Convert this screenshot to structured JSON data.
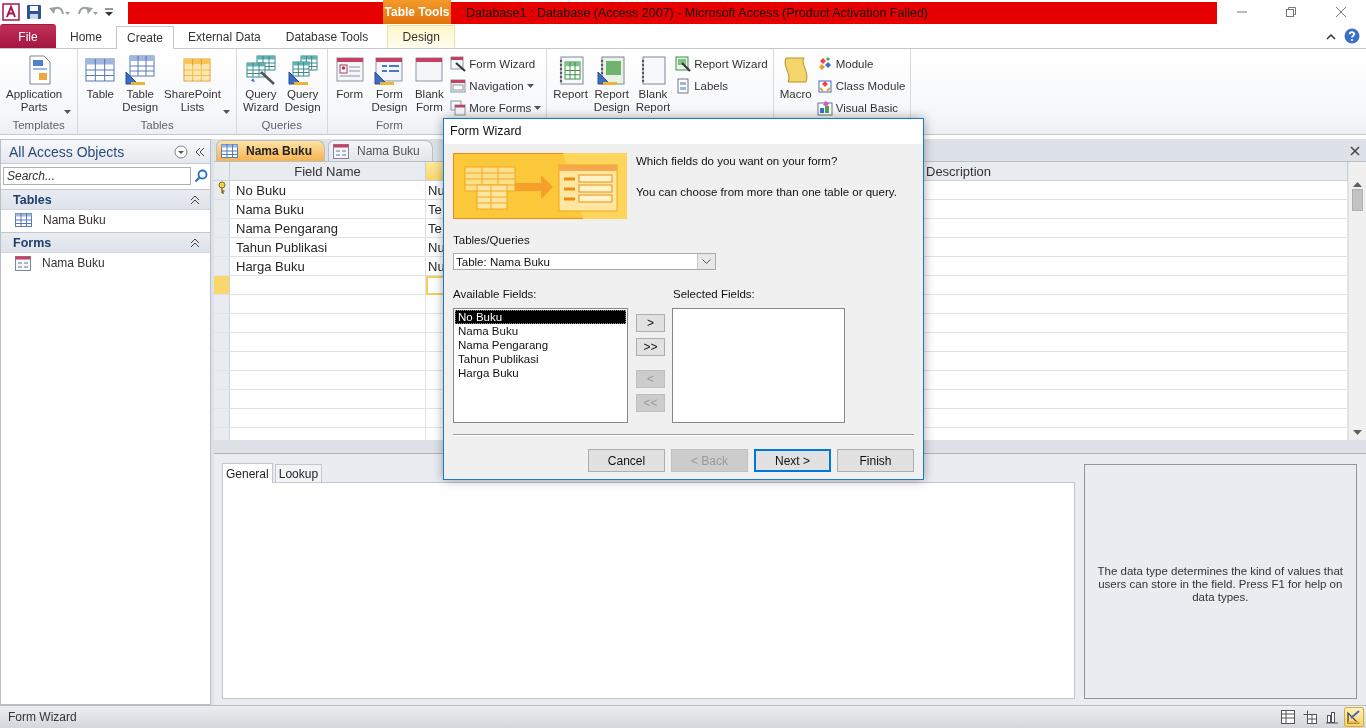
{
  "title_bar": {
    "contextual_group": "Table Tools",
    "title": "Database1 : Database (Access 2007)  -  Microsoft Access (Product Activation Failed)"
  },
  "ribbon_tabs": [
    {
      "label": "File",
      "kind": "file",
      "selected": false
    },
    {
      "label": "Home",
      "kind": "normal",
      "selected": false
    },
    {
      "label": "Create",
      "kind": "normal",
      "selected": true
    },
    {
      "label": "External Data",
      "kind": "normal",
      "selected": false
    },
    {
      "label": "Database Tools",
      "kind": "normal",
      "selected": false
    },
    {
      "label": "Design",
      "kind": "contextual",
      "selected": false
    }
  ],
  "ribbon_groups": [
    {
      "label": "Templates",
      "items": [
        {
          "kind": "large",
          "label": "Application Parts",
          "dropdown": true
        }
      ]
    },
    {
      "label": "Tables",
      "items": [
        {
          "kind": "large",
          "label": "Table",
          "dropdown": false
        },
        {
          "kind": "large",
          "label": "Table Design",
          "dropdown": false
        },
        {
          "kind": "large",
          "label": "SharePoint Lists",
          "dropdown": true
        }
      ]
    },
    {
      "label": "Queries",
      "items": [
        {
          "kind": "large",
          "label": "Query Wizard",
          "dropdown": false
        },
        {
          "kind": "large",
          "label": "Query Design",
          "dropdown": false
        }
      ]
    },
    {
      "label": "Form",
      "items": [
        {
          "kind": "large",
          "label": "Form",
          "dropdown": false
        },
        {
          "kind": "large",
          "label": "Form Design",
          "dropdown": false
        },
        {
          "kind": "large",
          "label": "Blank Form",
          "dropdown": false
        },
        {
          "kind": "small",
          "label": "Form Wizard",
          "dropdown": false
        },
        {
          "kind": "small",
          "label": "Navigation",
          "dropdown": true
        },
        {
          "kind": "small",
          "label": "More Forms",
          "dropdown": true
        }
      ]
    },
    {
      "items": [
        {
          "kind": "large",
          "label": "Report",
          "dropdown": false
        },
        {
          "kind": "large",
          "label": "Report Design",
          "dropdown": false
        },
        {
          "kind": "large",
          "label": "Blank Report",
          "dropdown": false
        },
        {
          "kind": "small",
          "label": "Report Wizard",
          "dropdown": false
        },
        {
          "kind": "small",
          "label": "Labels",
          "dropdown": false
        }
      ]
    },
    {
      "items": [
        {
          "kind": "large",
          "label": "Macro",
          "dropdown": false
        },
        {
          "kind": "small",
          "label": "Module",
          "dropdown": false
        },
        {
          "kind": "small",
          "label": "Class Module",
          "dropdown": false
        },
        {
          "kind": "small",
          "label": "Visual Basic",
          "dropdown": false
        }
      ]
    }
  ],
  "nav_pane": {
    "title": "All Access Objects",
    "search": {
      "placeholder": "Search..."
    },
    "groups": [
      {
        "label": "Tables",
        "expanded": true,
        "items": [
          {
            "label": "Nama Buku",
            "kind": "table"
          }
        ]
      },
      {
        "label": "Forms",
        "expanded": true,
        "items": [
          {
            "label": "Nama Buku",
            "kind": "form"
          }
        ]
      }
    ]
  },
  "document_tabs": [
    {
      "label": "Nama Buku",
      "kind": "table",
      "selected": true
    },
    {
      "label": "Nama Buku",
      "kind": "form",
      "selected": false
    }
  ],
  "table_design": {
    "field_name_header": "Field Name",
    "description_header": "Description",
    "rows": [
      {
        "field_name": "No Buku",
        "data_type": "Nu",
        "primary_key": true
      },
      {
        "field_name": "Nama Buku",
        "data_type": "Te",
        "primary_key": false
      },
      {
        "field_name": "Nama Pengarang",
        "data_type": "Te",
        "primary_key": false
      },
      {
        "field_name": "Tahun Publikasi",
        "data_type": "Nu",
        "primary_key": false
      },
      {
        "field_name": "Harga Buku",
        "data_type": "Nu",
        "primary_key": false
      }
    ],
    "new_row": {
      "selected": true
    }
  },
  "property_tabs": [
    {
      "label": "General",
      "selected": true
    },
    {
      "label": "Lookup",
      "selected": false
    }
  ],
  "help_text": "The data type determines the kind of values that users can store in the field. Press F1 for help on data types.",
  "dialog": {
    "title": "Form Wizard",
    "question": "Which fields do you want on your form?",
    "hint": "You can choose from more than one table or query.",
    "tables_label": "Tables/Queries",
    "tables_value": "Table: Nama Buku",
    "available_label": "Available Fields:",
    "selected_label": "Selected Fields:",
    "available_fields": [
      {
        "label": "No Buku",
        "selected": true
      },
      {
        "label": "Nama Buku",
        "selected": false
      },
      {
        "label": "Nama Pengarang",
        "selected": false
      },
      {
        "label": "Tahun Publikasi",
        "selected": false
      },
      {
        "label": "Harga Buku",
        "selected": false
      }
    ],
    "move_buttons": [
      {
        "label": ">",
        "disabled": false
      },
      {
        "label": ">>",
        "disabled": false
      },
      {
        "label": "<",
        "disabled": true
      },
      {
        "label": "<<",
        "disabled": true
      }
    ],
    "buttons": [
      {
        "label": "Cancel",
        "disabled": false,
        "default": false
      },
      {
        "label": "< Back",
        "disabled": true,
        "default": false
      },
      {
        "label": "Next >",
        "disabled": false,
        "default": true
      },
      {
        "label": "Finish",
        "disabled": false,
        "default": false
      }
    ]
  },
  "status_bar": {
    "text": "Form Wizard",
    "views": [
      {
        "selected": false
      },
      {
        "selected": false
      },
      {
        "selected": false
      },
      {
        "selected": true
      }
    ]
  }
}
